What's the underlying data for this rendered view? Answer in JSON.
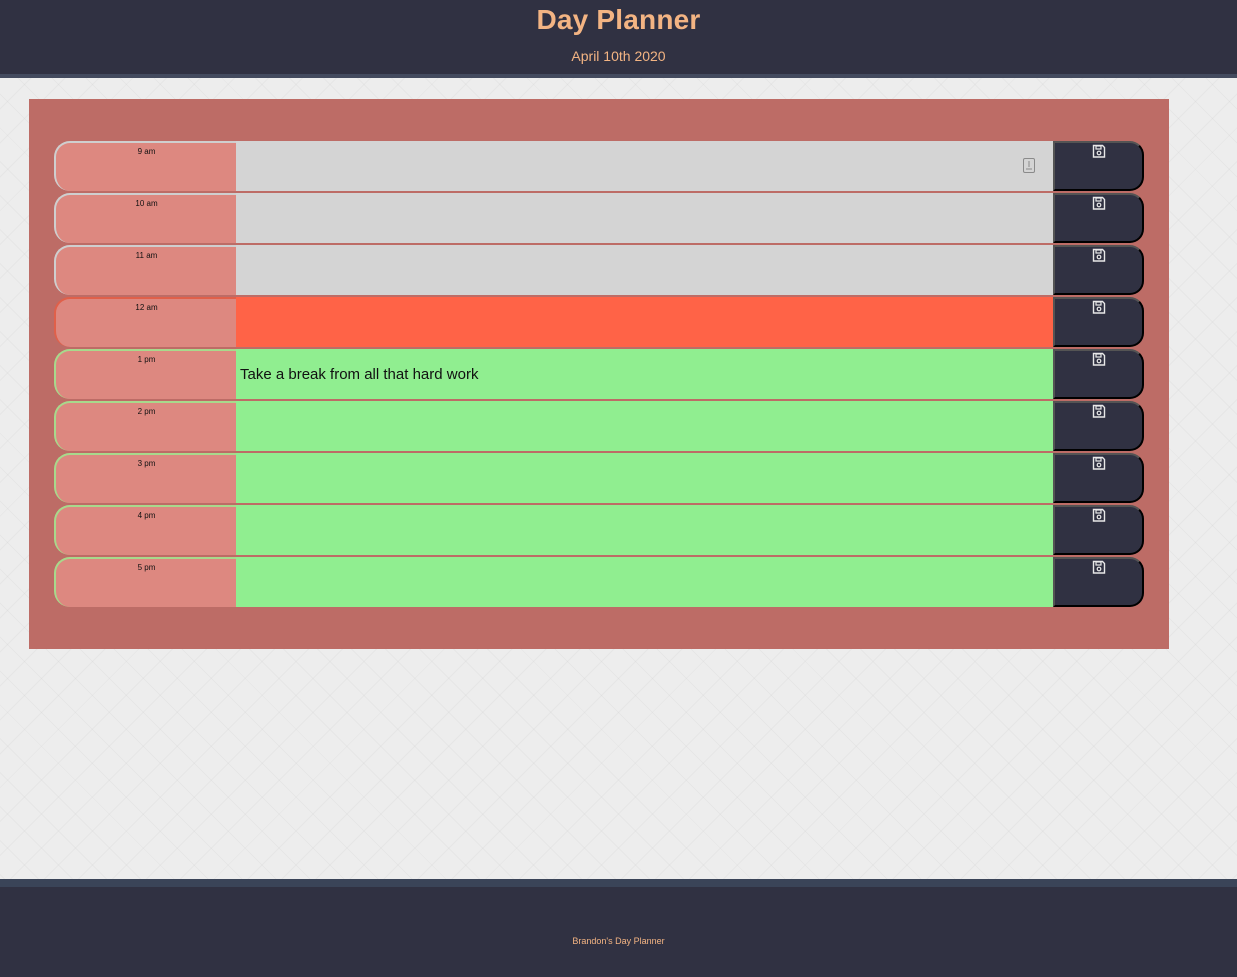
{
  "header": {
    "title": "Day Planner",
    "date": "April 10th 2020"
  },
  "rows": [
    {
      "hour": "9 am",
      "text": "",
      "state": "past"
    },
    {
      "hour": "10 am",
      "text": "",
      "state": "past"
    },
    {
      "hour": "11 am",
      "text": "",
      "state": "past"
    },
    {
      "hour": "12 am",
      "text": "",
      "state": "present"
    },
    {
      "hour": "1 pm",
      "text": "Take a break from all that hard work",
      "state": "future"
    },
    {
      "hour": "2 pm",
      "text": "",
      "state": "future"
    },
    {
      "hour": "3 pm",
      "text": "",
      "state": "future"
    },
    {
      "hour": "4 pm",
      "text": "",
      "state": "future"
    },
    {
      "hour": "5 pm",
      "text": "",
      "state": "future"
    }
  ],
  "icons": {
    "save": "floppy-disk-icon",
    "resize": "textarea-resize-icon"
  },
  "colors": {
    "header_bg": "#303142",
    "accent_text": "#f3b483",
    "planner_bg": "#bd6c66",
    "hour_bg": "#dd8880",
    "past": "#d4d4d4",
    "present": "#ff6347",
    "future": "#90ee90"
  },
  "footer": {
    "credit": "Brandon's Day Planner"
  }
}
